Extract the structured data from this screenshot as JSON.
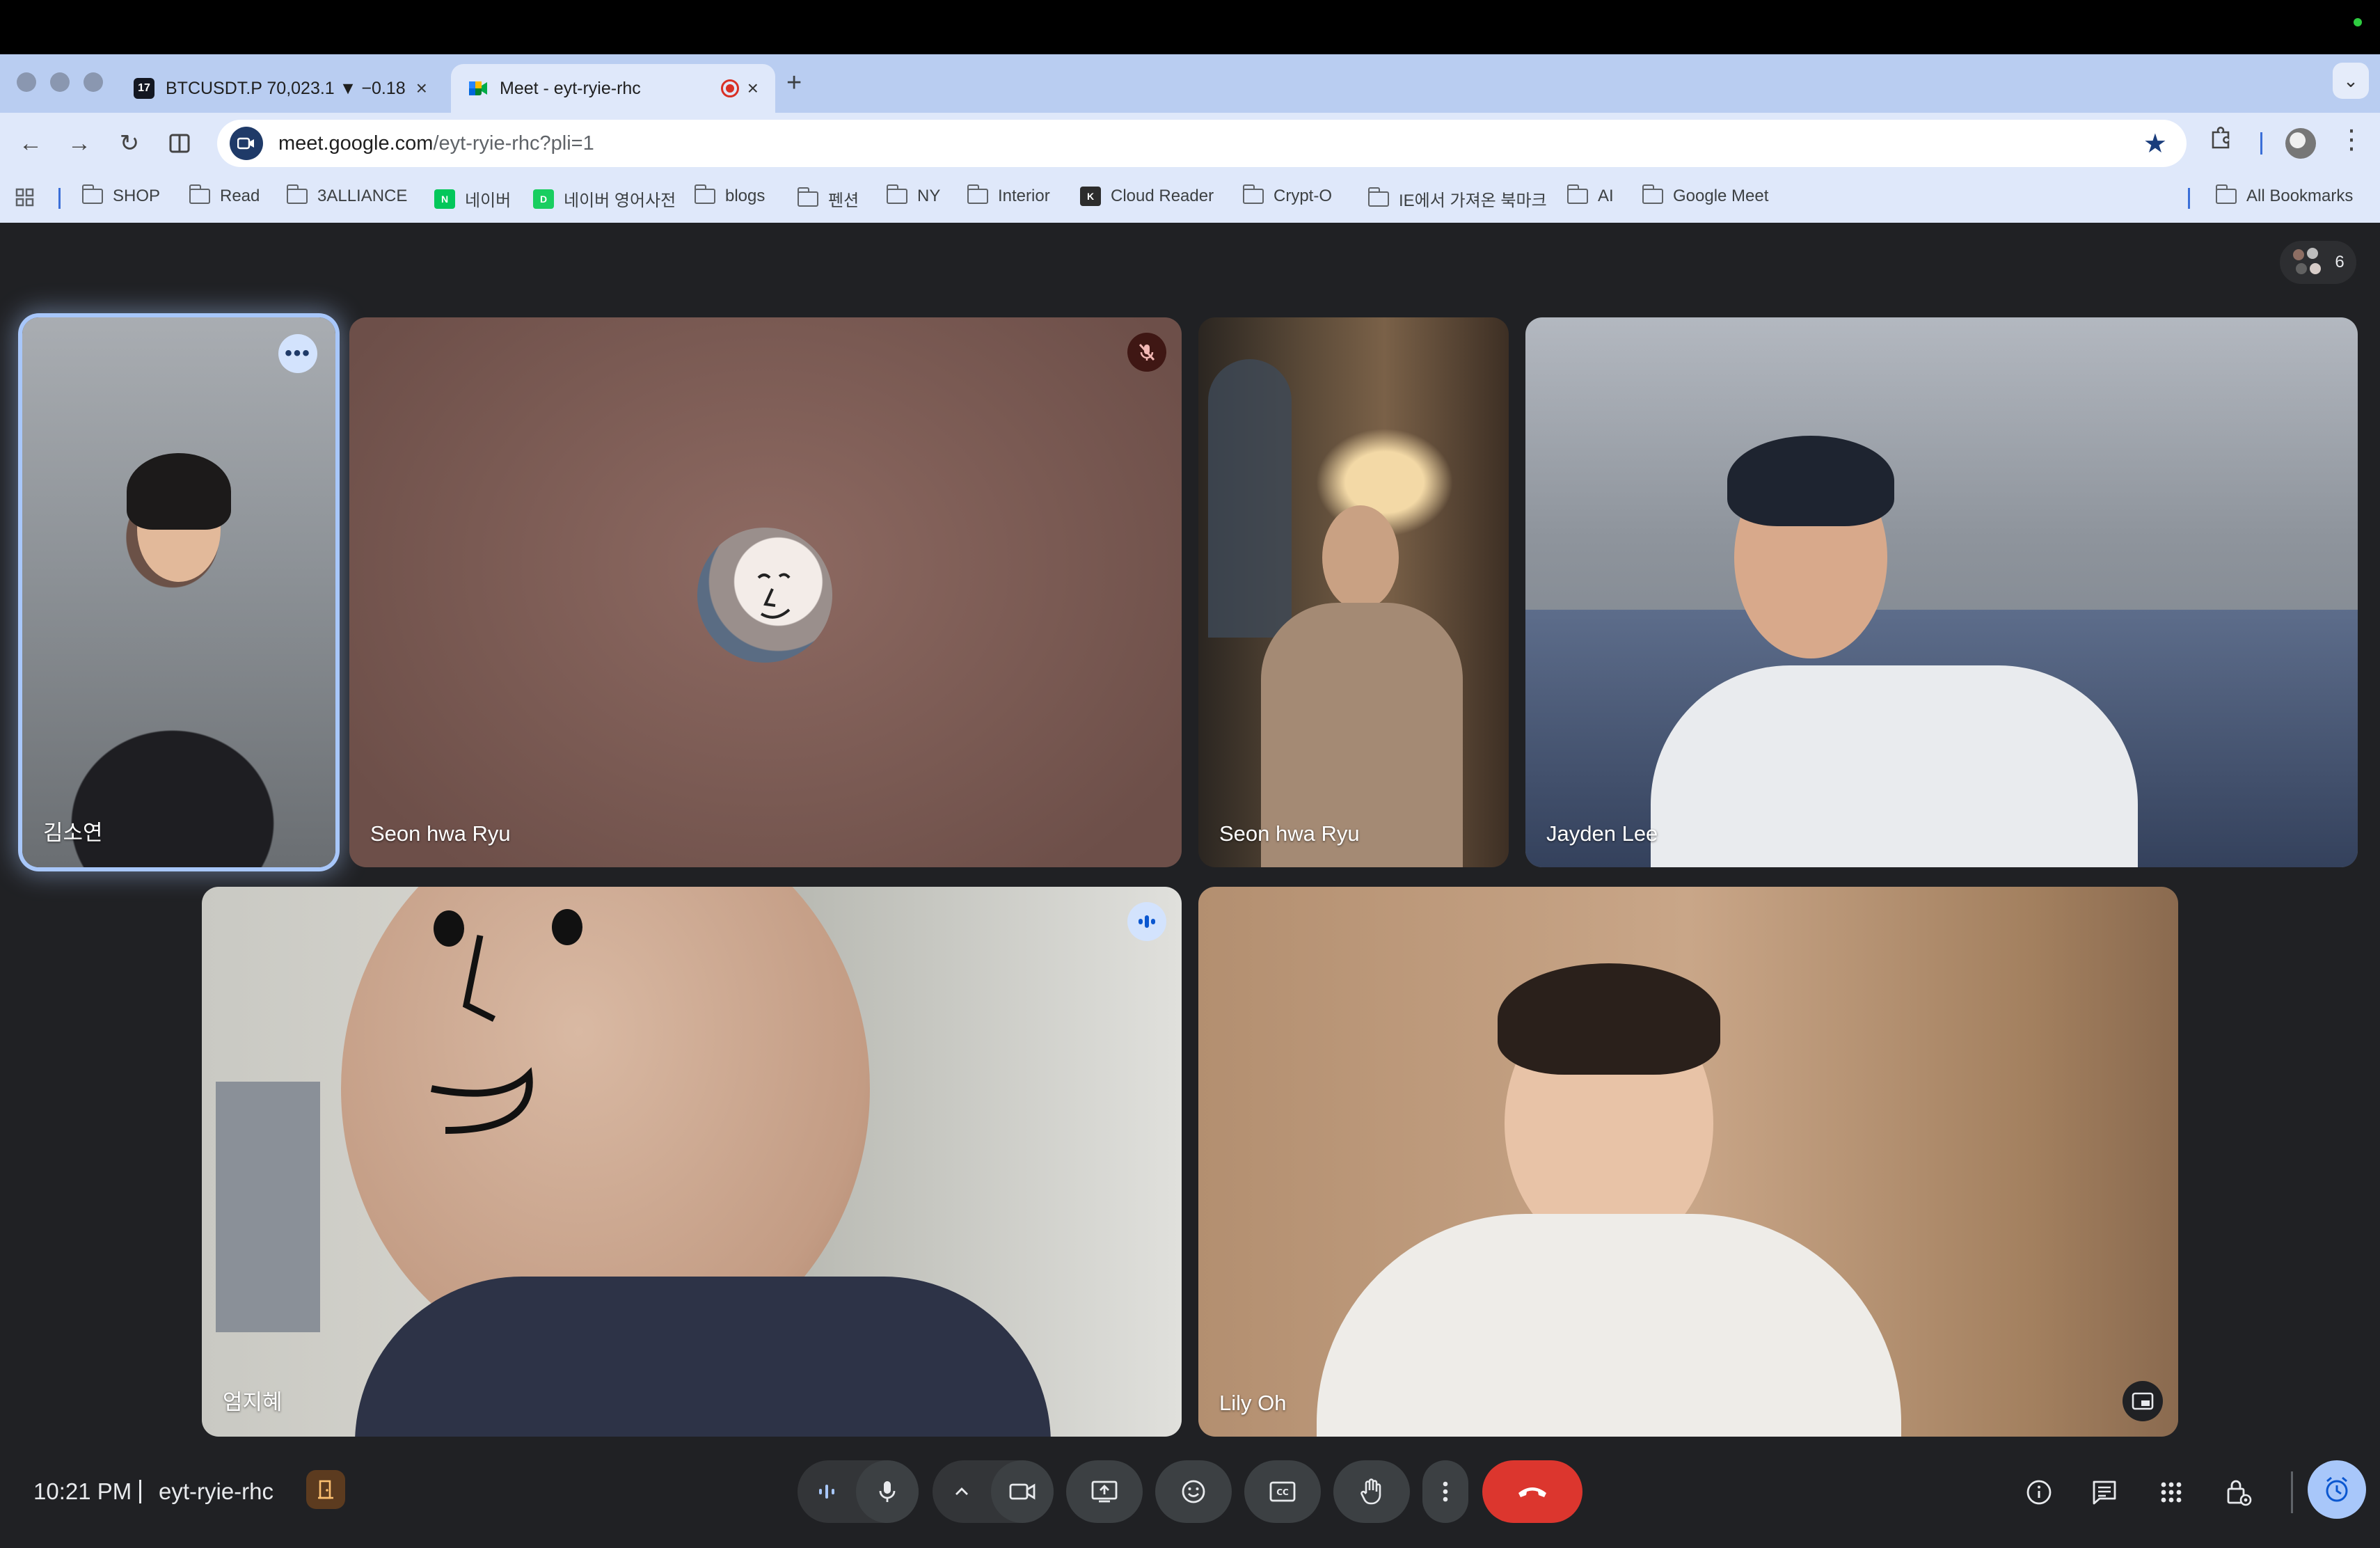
{
  "browser": {
    "tabs": [
      {
        "title": "BTCUSDT.P 70,023.1 ▼ −0.18",
        "favicon": "tradingview-icon",
        "active": false
      },
      {
        "title": "Meet - eyt-ryie-rhc",
        "favicon": "google-meet-icon",
        "active": true,
        "recording": true
      }
    ],
    "new_tab_label": "+",
    "url_host": "meet.google.com",
    "url_path": "/eyt-ryie-rhc?pli=1",
    "bookmarks": [
      {
        "label": "SHOP",
        "type": "folder"
      },
      {
        "label": "Read",
        "type": "folder"
      },
      {
        "label": "3ALLIANCE",
        "type": "folder"
      },
      {
        "label": "네이버",
        "type": "site",
        "badge": "N",
        "color": "#03c75a"
      },
      {
        "label": "네이버 영어사전",
        "type": "site",
        "badge": "D",
        "color": "#19ce60"
      },
      {
        "label": "blogs",
        "type": "folder"
      },
      {
        "label": "펜션",
        "type": "folder"
      },
      {
        "label": "NY",
        "type": "folder"
      },
      {
        "label": "Interior",
        "type": "folder"
      },
      {
        "label": "Cloud Reader",
        "type": "site",
        "badge": "K",
        "color": "#2c2c2c"
      },
      {
        "label": "Crypt-O",
        "type": "folder"
      },
      {
        "label": "IE에서 가져온 북마크",
        "type": "folder"
      },
      {
        "label": "AI",
        "type": "folder"
      },
      {
        "label": "Google Meet",
        "type": "folder"
      }
    ],
    "all_bookmarks_label": "All Bookmarks"
  },
  "meet": {
    "participant_count": "6",
    "tiles": [
      {
        "name": "김소연",
        "indicator": "more-options"
      },
      {
        "name": "Seon hwa Ryu",
        "indicator": "muted"
      },
      {
        "name": "Seon hwa Ryu",
        "indicator": "none"
      },
      {
        "name": "Jayden Lee",
        "indicator": "none"
      },
      {
        "name": "엄지혜",
        "indicator": "speaking"
      },
      {
        "name": "Lily Oh",
        "indicator": "pip"
      }
    ],
    "footer": {
      "time": "10:21 PM",
      "meeting_code": "eyt-ryie-rhc"
    }
  },
  "colors": {
    "stage_bg": "#202124",
    "leave_red": "#dc362e",
    "accent_blue": "#a8c7fa",
    "chrome_tabstrip": "#b9cdf1",
    "chrome_toolbar": "#dfe8fa"
  }
}
